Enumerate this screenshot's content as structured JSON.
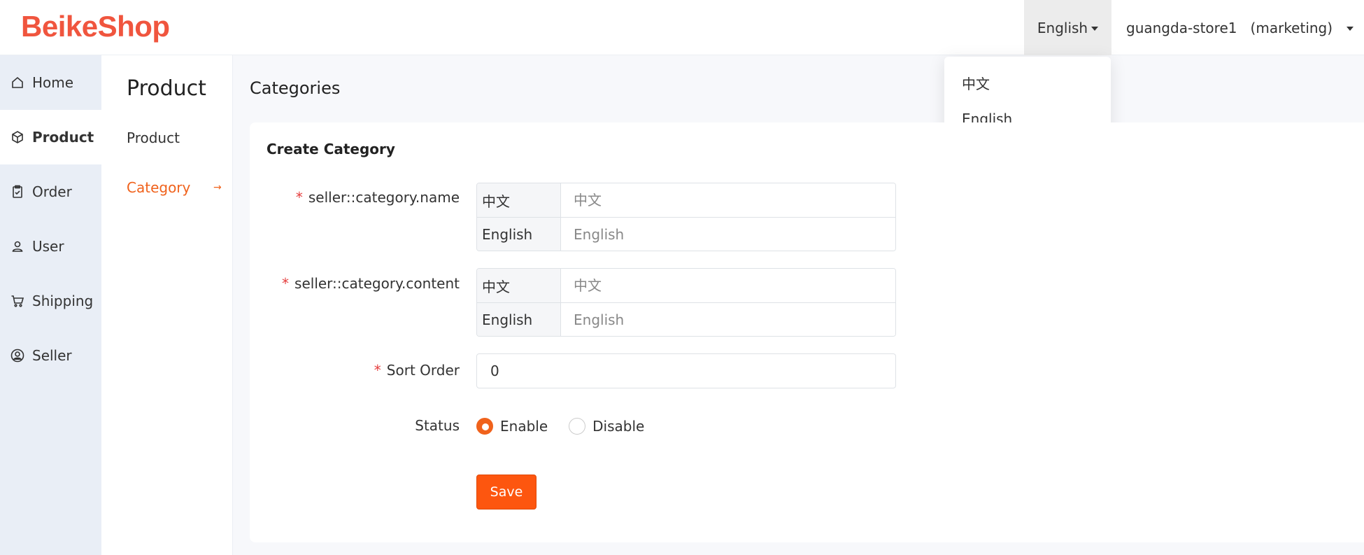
{
  "brand": {
    "logo_text": "BeikeShop",
    "accent_color": "#fd560f"
  },
  "header": {
    "language_label": "English",
    "user_label": "guangda-store1   (marketing)"
  },
  "language_dropdown": {
    "open": true,
    "options": [
      "中文",
      "English"
    ]
  },
  "sidebar": {
    "items": [
      {
        "label": "Home",
        "icon": "home-icon",
        "active": false
      },
      {
        "label": "Product",
        "icon": "box-icon",
        "active": true
      },
      {
        "label": "Order",
        "icon": "clipboard-icon",
        "active": false
      },
      {
        "label": "User",
        "icon": "user-icon",
        "active": false
      },
      {
        "label": "Shipping",
        "icon": "cart-icon",
        "active": false
      },
      {
        "label": "Seller",
        "icon": "user-circle-icon",
        "active": false
      }
    ]
  },
  "subnav": {
    "title": "Product",
    "items": [
      {
        "label": "Product",
        "active": false
      },
      {
        "label": "Category",
        "active": true
      }
    ],
    "active_arrow": "→"
  },
  "main": {
    "page_title": "Categories",
    "card_title": "Create Category",
    "form": {
      "name": {
        "label": "seller::category.name",
        "required": "*",
        "rows": [
          {
            "lang": "中文",
            "placeholder": "中文",
            "value": ""
          },
          {
            "lang": "English",
            "placeholder": "English",
            "value": ""
          }
        ]
      },
      "content": {
        "label": "seller::category.content",
        "required": "*",
        "rows": [
          {
            "lang": "中文",
            "placeholder": "中文",
            "value": ""
          },
          {
            "lang": "English",
            "placeholder": "English",
            "value": ""
          }
        ]
      },
      "sort_order": {
        "label": "Sort Order",
        "required": "*",
        "value": "0"
      },
      "status": {
        "label": "Status",
        "options": [
          {
            "label": "Enable",
            "checked": true
          },
          {
            "label": "Disable",
            "checked": false
          }
        ]
      },
      "save_label": "Save"
    }
  }
}
